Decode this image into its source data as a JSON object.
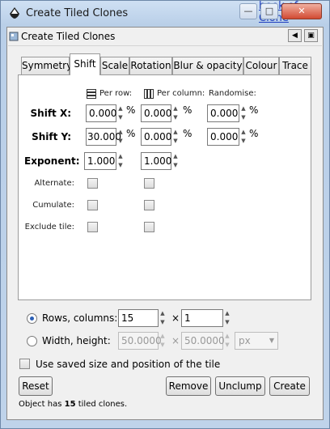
{
  "window": {
    "title": "Create Tiled Clones",
    "background_link": "book of Clone"
  },
  "dock": {
    "title": "Create Tiled Clones"
  },
  "tabs": [
    {
      "label": "Symmetry"
    },
    {
      "label": "Shift",
      "active": true
    },
    {
      "label": "Scale"
    },
    {
      "label": "Rotation"
    },
    {
      "label": "Blur & opacity"
    },
    {
      "label": "Colour"
    },
    {
      "label": "Trace"
    }
  ],
  "shift": {
    "col_headers": {
      "per_row": "Per row:",
      "per_column": "Per column:",
      "randomise": "Randomise:"
    },
    "shift_x": {
      "label": "Shift X:",
      "per_row": "0.000",
      "per_column": "0.000",
      "randomise": "0.000",
      "unit": "%"
    },
    "shift_y": {
      "label": "Shift Y:",
      "per_row": "30.000",
      "per_column": "0.000",
      "randomise": "0.000",
      "unit": "%"
    },
    "exponent": {
      "label": "Exponent:",
      "per_row": "1.000",
      "per_column": "1.000"
    },
    "alternate_label": "Alternate:",
    "cumulate_label": "Cumulate:",
    "exclude_tile_label": "Exclude tile:"
  },
  "size": {
    "rows_columns_label": "Rows, columns:",
    "rows": "15",
    "columns": "1",
    "times": "×",
    "width_height_label": "Width, height:",
    "width": "50.0000",
    "height": "50.0000",
    "unit": "px",
    "mode": "rows_columns"
  },
  "use_saved_label": "Use saved size and position of the tile",
  "buttons": {
    "reset": "Reset",
    "remove": "Remove",
    "unclump": "Unclump",
    "create": "Create"
  },
  "status": {
    "prefix": "Object has ",
    "count": "15",
    "suffix": " tiled clones."
  }
}
